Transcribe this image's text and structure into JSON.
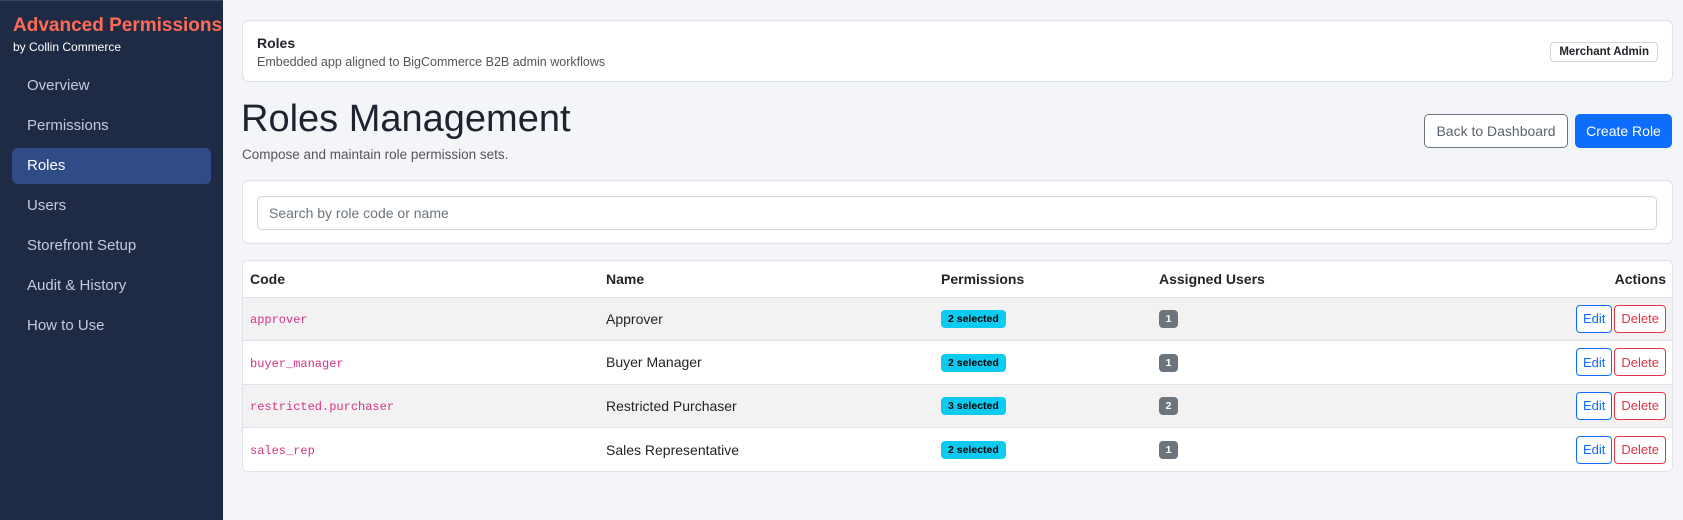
{
  "brand": {
    "title": "Advanced Permissions",
    "subtitle": "by Collin Commerce"
  },
  "sidebar": {
    "items": [
      {
        "label": "Overview",
        "active": false
      },
      {
        "label": "Permissions",
        "active": false
      },
      {
        "label": "Roles",
        "active": true
      },
      {
        "label": "Users",
        "active": false
      },
      {
        "label": "Storefront Setup",
        "active": false
      },
      {
        "label": "Audit & History",
        "active": false
      },
      {
        "label": "How to Use",
        "active": false
      }
    ]
  },
  "header": {
    "title": "Roles",
    "subtitle": "Embedded app aligned to BigCommerce B2B admin workflows",
    "badge": "Merchant Admin"
  },
  "page": {
    "title": "Roles Management",
    "subtitle": "Compose and maintain role permission sets.",
    "back_label": "Back to Dashboard",
    "create_label": "Create Role"
  },
  "search": {
    "placeholder": "Search by role code or name",
    "value": ""
  },
  "table": {
    "headers": {
      "code": "Code",
      "name": "Name",
      "permissions": "Permissions",
      "users": "Assigned Users",
      "actions": "Actions"
    },
    "edit_label": "Edit",
    "delete_label": "Delete",
    "rows": [
      {
        "code": "approver",
        "name": "Approver",
        "permissions": "2 selected",
        "users": "1"
      },
      {
        "code": "buyer_manager",
        "name": "Buyer Manager",
        "permissions": "2 selected",
        "users": "1"
      },
      {
        "code": "restricted.purchaser",
        "name": "Restricted Purchaser",
        "permissions": "3 selected",
        "users": "2"
      },
      {
        "code": "sales_rep",
        "name": "Sales Representative",
        "permissions": "2 selected",
        "users": "1"
      }
    ]
  },
  "colors": {
    "sidebar_bg": "#1f2b44",
    "brand": "#ff6b57",
    "primary": "#0d6efd",
    "danger": "#dc3545",
    "info": "#0dcaf0",
    "secondary": "#6c757d",
    "code": "#d63384"
  }
}
